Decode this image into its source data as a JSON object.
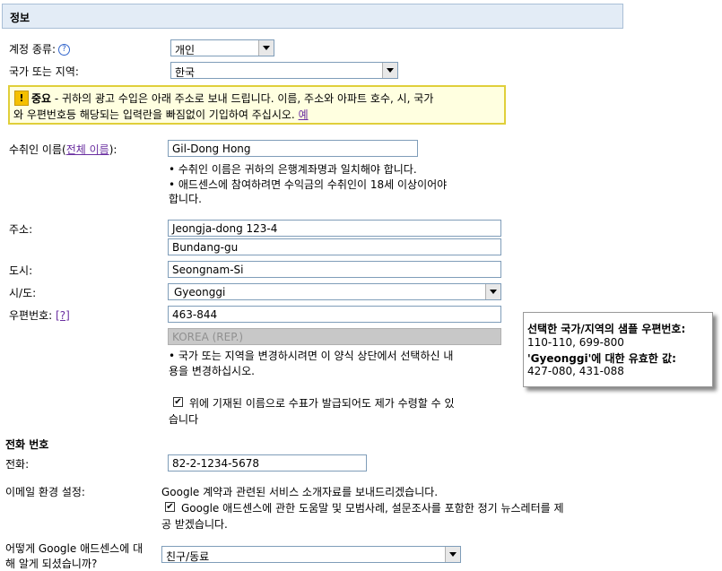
{
  "header": {
    "title": "정보"
  },
  "account_type": {
    "label": "계정 종류:",
    "value": "개인"
  },
  "country": {
    "label": "국가 또는 지역:",
    "value": "한국"
  },
  "notice": {
    "icon": "!",
    "bold": "중요",
    "line1": " - 귀하의 광고 수입은 아래 주소로 보내 드립니다. 이름, 주소와 아파트 호수, 시, 국가",
    "line2": "와 우편번호등 해당되는 입력란을 빠짐없이 기입하여 주십시오. ",
    "example_link": "예"
  },
  "payee": {
    "label_prefix": "수취인 이름(",
    "label_link": "전체 이름",
    "label_suffix": "):",
    "value": "Gil-Dong Hong",
    "notes": [
      "• 수취인 이름은 귀하의 은행계좌명과 일치해야 합니다.",
      "• 애드센스에 참여하려면 수익금의 수취인이 18세 이상이어야",
      "합니다."
    ]
  },
  "address": {
    "label": "주소:",
    "line1": "Jeongja-dong 123-4",
    "line2": "Bundang-gu"
  },
  "city": {
    "label": "도시:",
    "value": "Seongnam-Si"
  },
  "province": {
    "label": "시/도:",
    "value": "Gyeonggi"
  },
  "postal": {
    "label": "우편번호:",
    "help": "[?]",
    "value": "463-844",
    "country_display": "KOREA (REP.)",
    "notes": [
      "• 국가 또는 지역을 변경하시려면 이 양식 상단에서 선택하신 내",
      "용을 변경하십시오."
    ]
  },
  "confirm": {
    "checked": true,
    "line1": "위에 기재된 이름으로 수표가 발급되어도 제가 수령할 수 있",
    "line2": "습니다"
  },
  "tooltip": {
    "title": "선택한 국가/지역의 샘플 우편번호:",
    "samples": "110-110, 699-800",
    "valid_bold": "'Gyeonggi'",
    "valid_rest": "에 대한 유효한 값:",
    "valid_values": "427-080, 431-088"
  },
  "phone_section": {
    "title": "전화 번호"
  },
  "phone": {
    "label": "전화:",
    "value": "82-2-1234-5678"
  },
  "email_pref": {
    "label": "이메일 환경 설정:",
    "text": "Google 계약과 관련된 서비스 소개자료를 보내드리겠습니다.",
    "newsletter_checked": true,
    "newsletter_line1": "Google 애드센스에 관한 도움말 및 모범사례, 설문조사를 포함한 정기 뉴스레터를 제",
    "newsletter_line2": "공 받겠습니다."
  },
  "referral": {
    "label_line1": "어떻게 Google 애드센스에 대",
    "label_line2": "해 알게 되셨습니까?",
    "value": "친구/동료"
  }
}
